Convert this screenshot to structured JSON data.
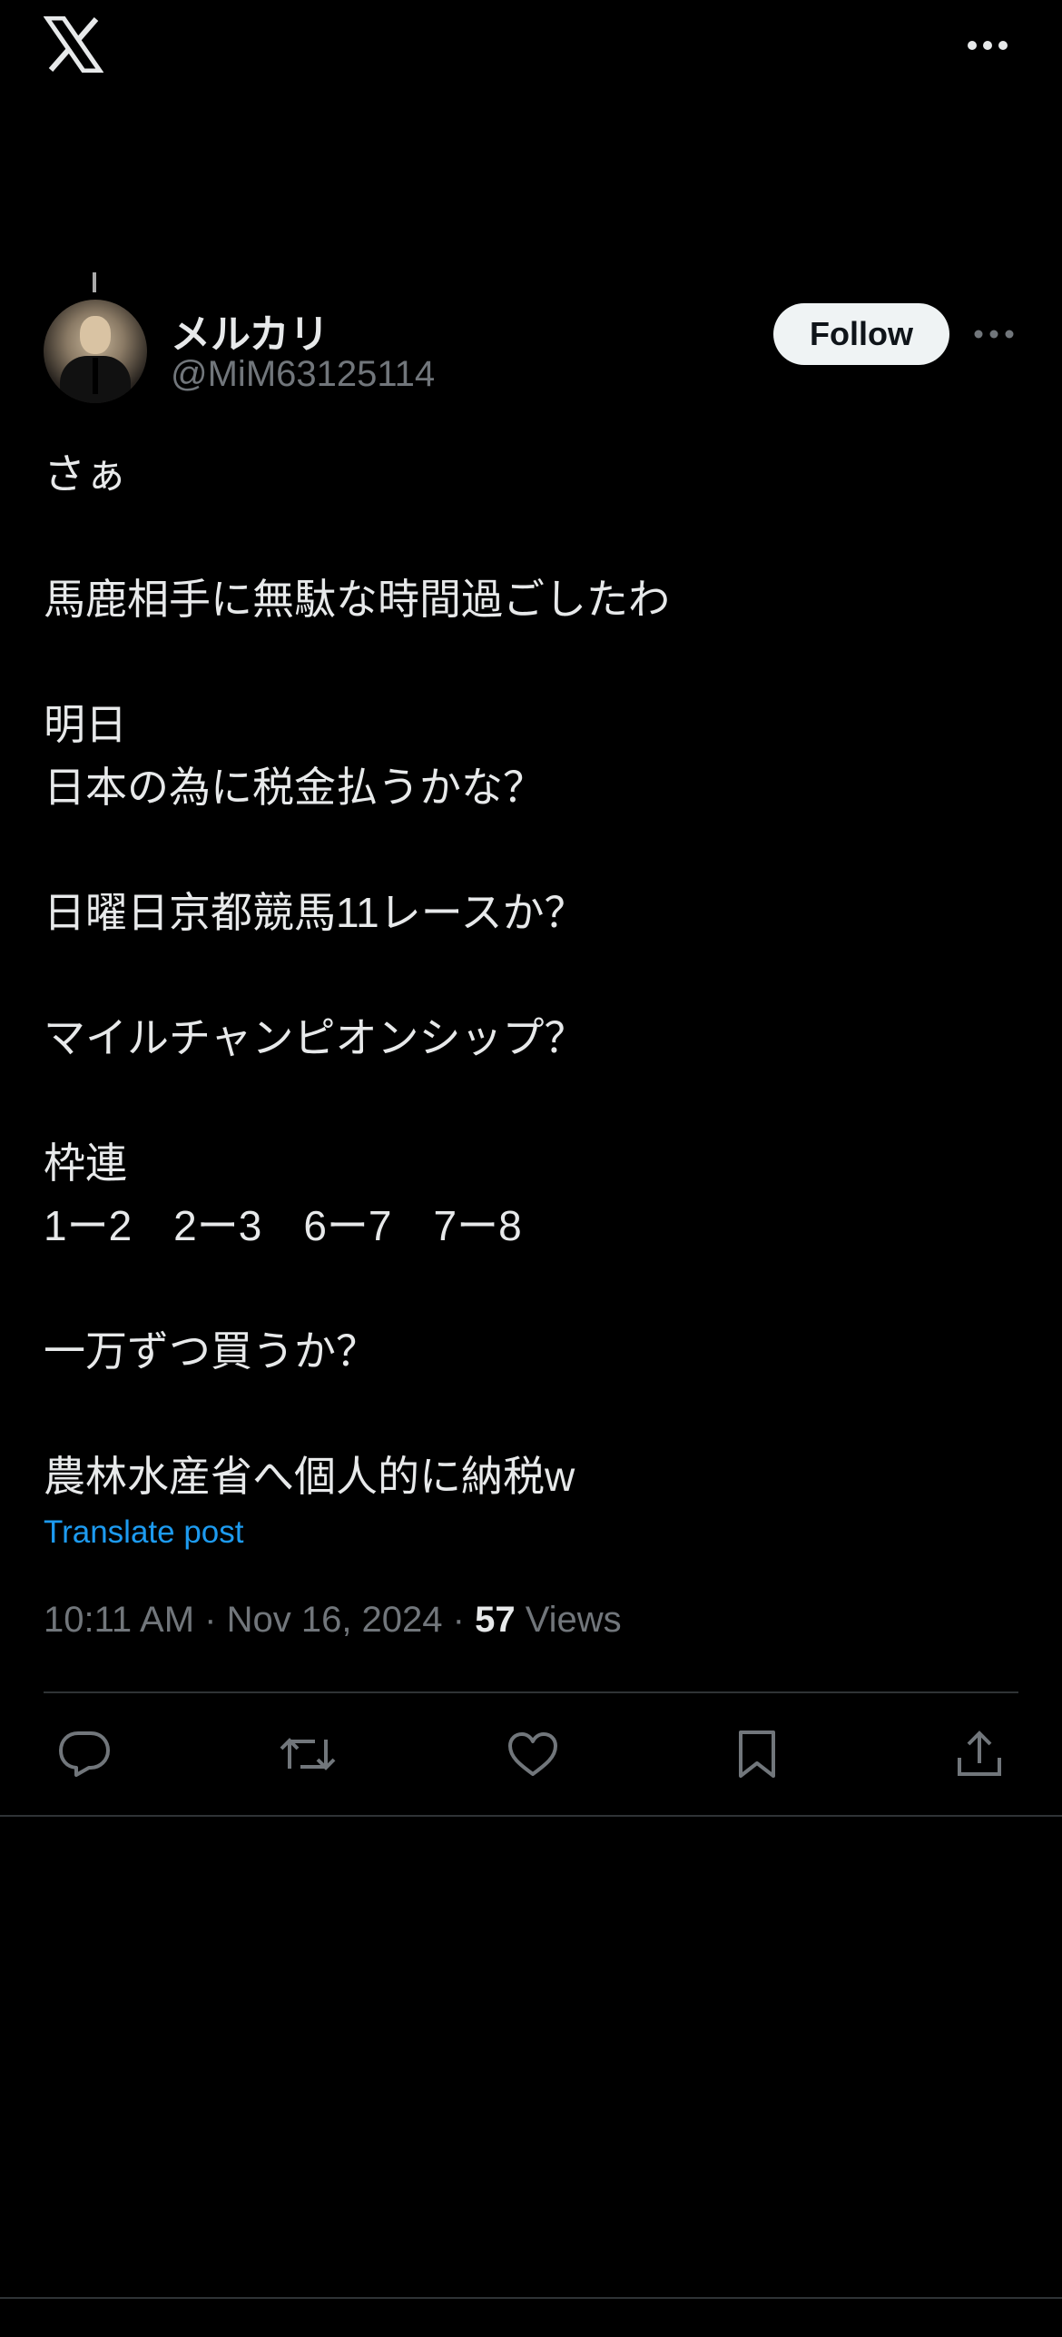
{
  "header": {
    "logo": "x-logo-icon",
    "more_icon": "more-horizontal-icon"
  },
  "author": {
    "name": "メルカリ",
    "handle": "@MiM63125114",
    "follow_label": "Follow"
  },
  "post": {
    "lines": [
      "さぁ",
      "馬鹿相手に無駄な時間過ごしたわ",
      "明日",
      "日本の為に税金払うかな？",
      "日曜日京都競馬11レースか？",
      "マイルチャンピオンシップ？",
      "枠連",
      "1ー2　2ー3　6ー7　7ー8",
      "一万ずつ買うか？",
      "農林水産省へ個人的に納税w"
    ],
    "translate_label": "Translate post"
  },
  "meta": {
    "time": "10:11 AM",
    "sep1": " · ",
    "date": "Nov 16, 2024",
    "sep2": " · ",
    "views_count": "57",
    "views_label": " Views"
  },
  "actions": [
    "reply-icon",
    "repost-icon",
    "like-icon",
    "bookmark-icon",
    "share-icon"
  ],
  "colors": {
    "background": "#000000",
    "text": "#e7e9ea",
    "muted": "#71767b",
    "link": "#1d9bf0",
    "divider": "#2f3336",
    "follow_bg": "#eff3f4"
  }
}
